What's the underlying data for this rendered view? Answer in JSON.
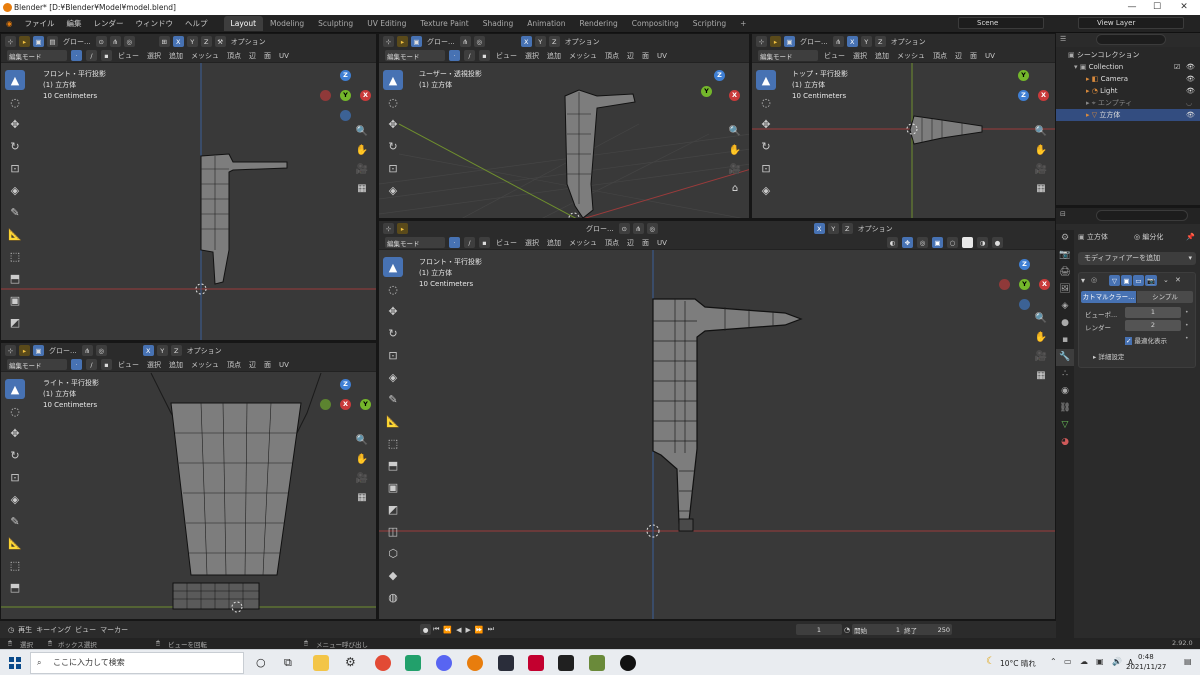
{
  "window": {
    "title": "Blender* [D:¥Blender¥Model¥model.blend]",
    "controls": [
      "—",
      "☐",
      "✕"
    ]
  },
  "menu": [
    "ファイル",
    "編集",
    "レンダー",
    "ウィンドウ",
    "ヘルプ"
  ],
  "workspaces": [
    "Layout",
    "Modeling",
    "Sculpting",
    "UV Editing",
    "Texture Paint",
    "Shading",
    "Animation",
    "Rendering",
    "Compositing",
    "Scripting",
    "+"
  ],
  "scene": "Scene",
  "view_layer": "View Layer",
  "header": {
    "mode": "編集モード",
    "menus": [
      "ビュー",
      "選択",
      "追加",
      "メッシュ",
      "頂点",
      "辺",
      "面",
      "UV"
    ],
    "transform": "グロー...",
    "option": "オプション",
    "axes": [
      "X",
      "Y",
      "Z"
    ]
  },
  "viewports": {
    "front_small": {
      "view": "フロント・平行投影",
      "object": "(1) 立方体",
      "scale": "10 Centimeters"
    },
    "user_persp": {
      "view": "ユーザー・透視投影",
      "object": "(1) 立方体"
    },
    "top": {
      "view": "トップ・平行投影",
      "object": "(1) 立方体",
      "scale": "10 Centimeters"
    },
    "right": {
      "view": "ライト・平行投影",
      "object": "(1) 立方体",
      "scale": "10 Centimeters"
    },
    "front_big": {
      "view": "フロント・平行投影",
      "object": "(1) 立方体",
      "scale": "10 Centimeters"
    }
  },
  "outliner": {
    "root": "シーンコレクション",
    "collection": "Collection",
    "items": [
      "Camera",
      "Light",
      "エンプティ",
      "立方体"
    ]
  },
  "properties": {
    "object": "立方体",
    "link": "編分化",
    "add_modifier": "モディファイアーを追加",
    "tabs": [
      "カトマルクラー...",
      "シンプル"
    ],
    "fields": [
      {
        "label": "ビューポ...",
        "value": "1"
      },
      {
        "label": "レンダー",
        "value": "2"
      }
    ],
    "checkbox": "最適化表示",
    "advanced": "詳細設定"
  },
  "timeline": {
    "menus": [
      "再生",
      "キーイング",
      "ビュー",
      "マーカー"
    ],
    "frame": "1",
    "start_label": "開始",
    "start": "1",
    "end_label": "終了",
    "end": "250"
  },
  "status": {
    "items": [
      "選択",
      "ボックス選択",
      "ビューを回転",
      "メニュー呼び出し"
    ],
    "version": "2.92.0"
  },
  "taskbar": {
    "search": "ここに入力して検索",
    "weather": "10°C 晴れ",
    "time": "0:48",
    "date": "2021/11/27",
    "lang": "A"
  },
  "colors": {
    "accent": "#4772b3",
    "x_axis": "#c93a3a",
    "y_axis": "#74b72b",
    "z_axis": "#3f7fd3",
    "viewport_bg": "#393939"
  }
}
